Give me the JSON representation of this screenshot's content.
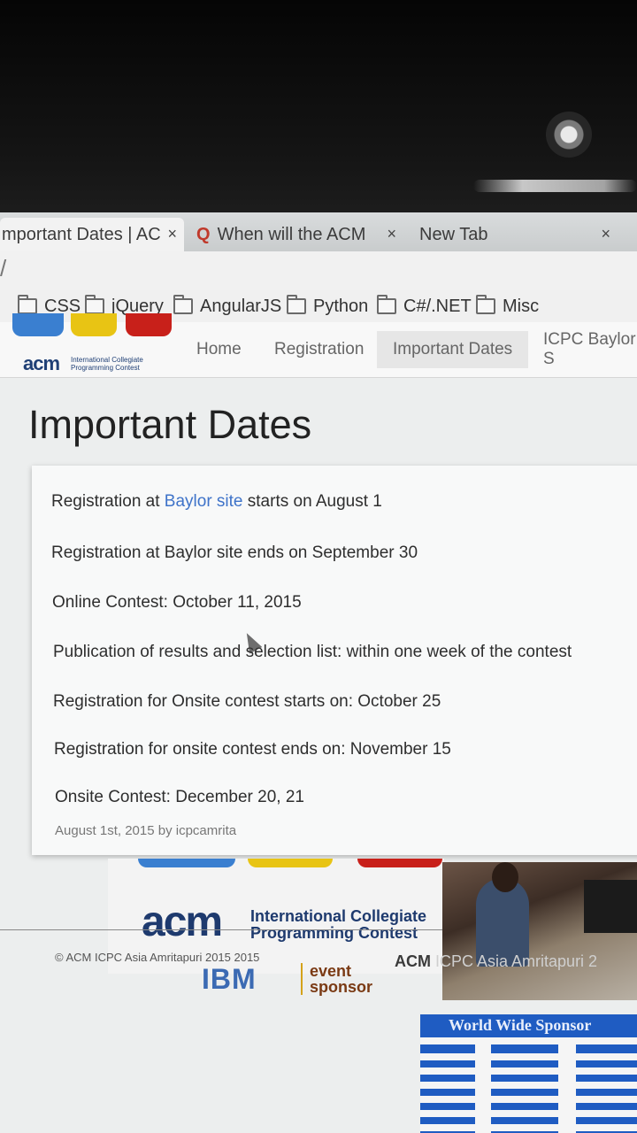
{
  "browser": {
    "tabs": [
      {
        "label": "mportant Dates | AC",
        "close": "×",
        "active": true
      },
      {
        "label": "When will the ACM",
        "close": "×",
        "active": false,
        "icon": "quora-icon",
        "icon_glyph": "Q"
      },
      {
        "label": "New Tab",
        "close": "×",
        "active": false
      }
    ],
    "address": "/",
    "bookmarks": [
      "CSS",
      "jQuery",
      "AngularJS",
      "Python",
      "C#/.NET",
      "Misc"
    ]
  },
  "site": {
    "logo": {
      "acm": "acm",
      "subtitle_line1": "International Collegiate",
      "subtitle_line2": "Programming Contest"
    },
    "nav": [
      "Home",
      "Registration",
      "Important Dates",
      "ICPC Baylor S"
    ],
    "active_nav": "Important Dates"
  },
  "main": {
    "title": "Important Dates",
    "first_line": {
      "prefix": "Registration at ",
      "link": "Baylor site",
      "suffix": " starts on August 1"
    },
    "dates": [
      "Registration at Baylor site ends on September 30",
      "Online Contest: October 11, 2015",
      "Publication of results and selection list: within one week of the contest",
      "Registration for Onsite contest starts on: October 25",
      "Registration for onsite contest ends on: November 15",
      "Onsite Contest: December 20, 21"
    ],
    "meta": "August 1st, 2015 by icpcamrita"
  },
  "footer": {
    "acm": "acm",
    "acm_subtitle_line1": "International Collegiate",
    "acm_subtitle_line2": "Programming Contest",
    "copyright": "© ACM ICPC Asia Amritapuri 2015 2015",
    "ibm": "IBM",
    "event_sponsor_line1": "event",
    "event_sponsor_line2": "sponsor",
    "photo_caption_bold": "ACM",
    "photo_caption_rest": " ICPC Asia Amritapuri 2",
    "world_wide_sponsor": "World Wide Sponsor"
  },
  "colors": {
    "link": "#3e73c9",
    "acm_blue": "#1f3f75",
    "ibm_blue": "#1f5cc2",
    "logo_blue": "#3a7fd0",
    "logo_yellow": "#e8c414",
    "logo_red": "#c8201a"
  }
}
